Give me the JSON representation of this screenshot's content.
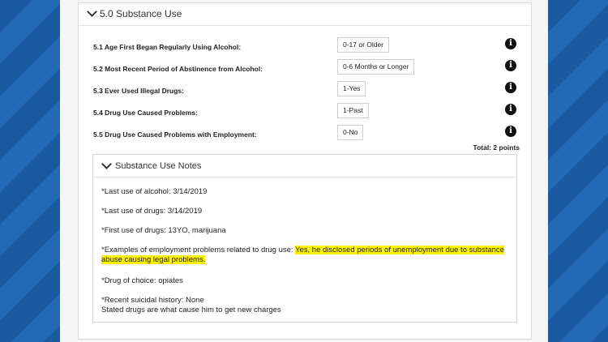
{
  "section": {
    "title": "5.0 Substance Use",
    "questions": [
      {
        "label": "5.1 Age First Began Regularly Using Alcohol:",
        "answer": "0-17 or Older"
      },
      {
        "label": "5.2 Most Recent Period of Abstinence from Alcohol:",
        "answer": "0-6 Months or Longer"
      },
      {
        "label": "5.3 Ever Used Illegal Drugs:",
        "answer": "1-Yes"
      },
      {
        "label": "5.4 Drug Use Caused Problems:",
        "answer": "1-Past"
      },
      {
        "label": "5.5 Drug Use Caused Problems with Employment:",
        "answer": "0-No"
      }
    ],
    "total": "Total: 2 points"
  },
  "notes": {
    "title": "Substance Use Notes",
    "items": [
      "*Last use of alcohol: 3/14/2019",
      "*Last use of drugs: 3/14/2019",
      "*First use of drugs: 13YO, marijuana"
    ],
    "employment_prefix": "*Examples of employment problems related to drug use: ",
    "employment_highlight_line1": "Yes, he disclosed periods of unemployment due to substance",
    "employment_highlight_line2": "abuse causing legal problems.",
    "drug_of_choice": "*Drug of choice: opiates",
    "suicidal_history": "*Recent suicidal history: None",
    "stated_drugs": "Stated drugs are what cause him to get new charges"
  },
  "icons": {
    "collapse": "chevron-down-icon",
    "info": "info-icon"
  },
  "colors": {
    "highlight": "#fff200",
    "background_blue": "#1c5fa6"
  }
}
